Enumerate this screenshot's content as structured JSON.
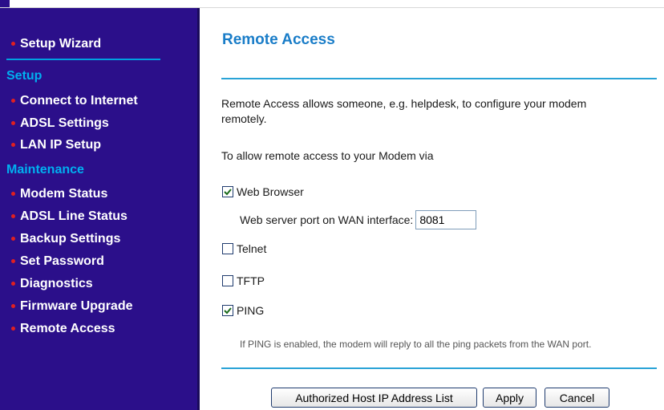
{
  "sidebar": {
    "setup_wizard": "Setup Wizard",
    "sections": {
      "setup": "Setup",
      "maintenance": "Maintenance"
    },
    "setup_items": [
      "Connect to Internet",
      "ADSL Settings",
      "LAN IP Setup"
    ],
    "maintenance_items": [
      "Modem Status",
      "ADSL Line Status",
      "Backup Settings",
      "Set Password",
      "Diagnostics",
      "Firmware Upgrade",
      "Remote Access"
    ]
  },
  "main": {
    "title": "Remote Access",
    "description": "Remote Access allows someone, e.g. helpdesk, to configure your modem remotely.",
    "allow_text": "To allow remote access to your Modem via",
    "options": {
      "web_browser": {
        "label": "Web Browser",
        "checked": true
      },
      "telnet": {
        "label": "Telnet",
        "checked": false
      },
      "tftp": {
        "label": "TFTP",
        "checked": false
      },
      "ping": {
        "label": "PING",
        "checked": true
      }
    },
    "port_label": "Web server port on WAN interface:",
    "port_value": "8081",
    "ping_note": "If PING is enabled, the modem will reply to all the ping packets from the WAN port.",
    "buttons": {
      "authorized": "Authorized Host IP Address List",
      "apply": "Apply",
      "cancel": "Cancel"
    }
  },
  "colors": {
    "sidebar_bg": "#2b0f8a",
    "section_title": "#00b0f0",
    "bullet": "#e02020",
    "page_title": "#1a7dc8",
    "rule": "#29a3d6"
  }
}
